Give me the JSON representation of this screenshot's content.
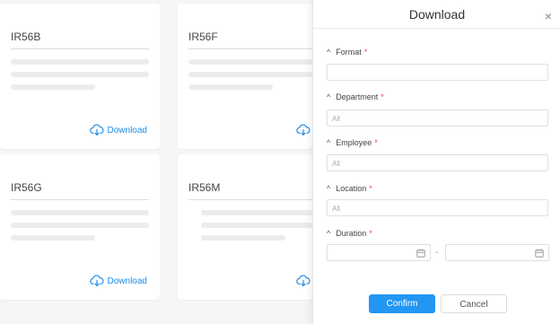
{
  "cards": [
    {
      "code": "IR56B",
      "download_label": "Download"
    },
    {
      "code": "IR56F",
      "download_label": "Download"
    },
    {
      "code": "IR56G",
      "download_label": "Download"
    },
    {
      "code": "IR56M",
      "download_label": "Download"
    }
  ],
  "modal": {
    "title": "Download",
    "close_icon": "×",
    "fields": {
      "format": {
        "label": "Format",
        "value": "",
        "placeholder": ""
      },
      "department": {
        "label": "Department",
        "placeholder": "All"
      },
      "employee": {
        "label": "Employee",
        "placeholder": "All"
      },
      "location": {
        "label": "Location",
        "placeholder": "All"
      },
      "duration": {
        "label": "Duration",
        "separator": "-"
      }
    },
    "required_mark": "*",
    "caret": "^",
    "confirm_label": "Confirm",
    "cancel_label": "Cancel"
  },
  "colors": {
    "accent": "#2196f3",
    "link": "#1e8de8",
    "required": "#e5484d"
  }
}
